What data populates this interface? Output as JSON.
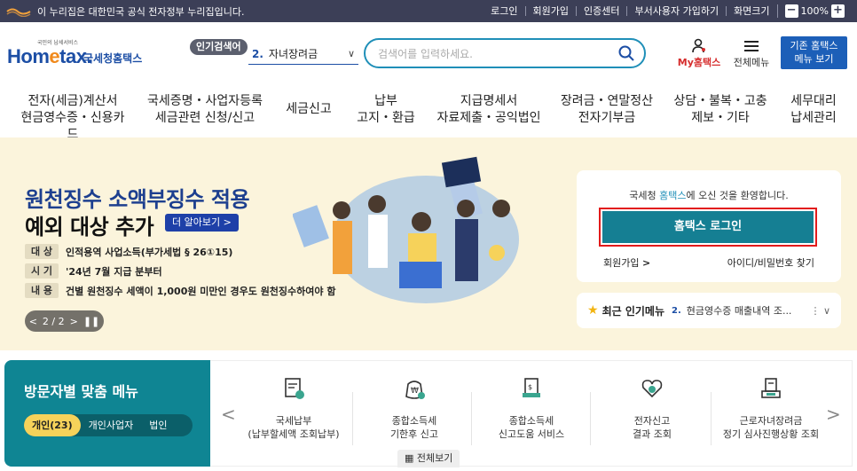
{
  "gov_bar": {
    "notice": "이 누리집은 대한민국 공식 전자정부 누리집입니다.",
    "links": [
      "로그인",
      "회원가입",
      "인증센터",
      "부서사용자 가입하기",
      "화면크기"
    ],
    "zoom": "100%"
  },
  "header": {
    "logo_small": "국민의 납세서비스",
    "logo_brand_a": "Hom",
    "logo_brand_b": "e",
    "logo_brand_c": "tax.",
    "logo_korean": "국세청홈택스",
    "popular_badge": "인기검색어",
    "popular_num": "2.",
    "popular_value": "자녀장려금",
    "search_placeholder": "검색어를 입력하세요.",
    "my_hometax": "My홈택스",
    "all_menu": "전체메뉴",
    "old_home_line1": "기존 홈택스",
    "old_home_line2": "메뉴 보기"
  },
  "nav": [
    {
      "line1": "전자(세금)계산서",
      "line2": "현금영수증・신용카드"
    },
    {
      "line1": "국세증명・사업자등록",
      "line2": "세금관련 신청/신고"
    },
    {
      "line1": "세금신고",
      "line2": ""
    },
    {
      "line1": "납부",
      "line2": "고지・환급"
    },
    {
      "line1": "지급명세서",
      "line2": "자료제출・공익법인"
    },
    {
      "line1": "장려금・연말정산",
      "line2": "전자기부금"
    },
    {
      "line1": "상담・불복・고충",
      "line2": "제보・기타"
    },
    {
      "line1": "세무대리",
      "line2": "납세관리"
    }
  ],
  "hero": {
    "title1": "원천징수 소액부징수 적용",
    "title2": "예외 대상 추가",
    "learn_more": "더 알아보기 >",
    "rows": [
      {
        "tag": "대 상",
        "text": "인적용역 사업소득(부가세법 § 26①15)"
      },
      {
        "tag": "시 기",
        "text": "'24년 7월 지급 분부터"
      },
      {
        "tag": "내 용",
        "text": "건별 원천징수 세액이 1,000원 미만인 경우도 원천징수하여야 함"
      }
    ],
    "pager": "2 / 2"
  },
  "login": {
    "welcome_a": "국세청 ",
    "welcome_hl": "홈택스",
    "welcome_b": "에 오신 것을 환영합니다.",
    "login_button": "홈택스 로그인",
    "join": "회원가입",
    "find": "아이디/비밀번호 찾기"
  },
  "recent": {
    "label": "최근 인기메뉴",
    "num": "2.",
    "value": "현금영수증 매출내역 조..."
  },
  "visitor": {
    "title": "방문자별 맞춤 메뉴",
    "tabs": [
      "개인(23)",
      "개인사업자",
      "법인"
    ]
  },
  "quick_menu": [
    {
      "line1": "국세납부",
      "line2": "(납부할세액 조회납부)",
      "icon": "tax-payment-icon"
    },
    {
      "line1": "종합소득세",
      "line2": "기한후 신고",
      "icon": "income-tax-late-icon"
    },
    {
      "line1": "종합소득세",
      "line2": "신고도움 서비스",
      "icon": "income-tax-help-icon"
    },
    {
      "line1": "전자신고",
      "line2": "결과 조회",
      "icon": "e-filing-result-icon"
    },
    {
      "line1": "근로자녀장려금",
      "line2": "정기 심사진행상황 조회",
      "icon": "child-incentive-icon"
    }
  ],
  "all_view": "전체보기"
}
